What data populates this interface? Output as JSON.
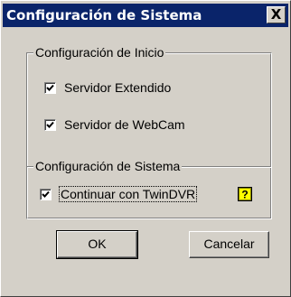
{
  "window": {
    "title": "Configuración de Sistema",
    "close_glyph": "X"
  },
  "group_inicio": {
    "legend": "Configuración de Inicio",
    "items": [
      {
        "label": "Servidor Extendido",
        "checked": true
      },
      {
        "label": "Servidor de WebCam",
        "checked": true
      }
    ]
  },
  "group_sistema": {
    "legend": "Configuración de Sistema",
    "items": [
      {
        "label": "Continuar con TwinDVR",
        "checked": true
      }
    ],
    "help_icon": "help-icon"
  },
  "buttons": {
    "ok_label": "OK",
    "cancel_label": "Cancelar"
  },
  "colors": {
    "title_bar": "#0a246a",
    "face": "#d4d0c8",
    "help_yellow": "#ffff00"
  }
}
